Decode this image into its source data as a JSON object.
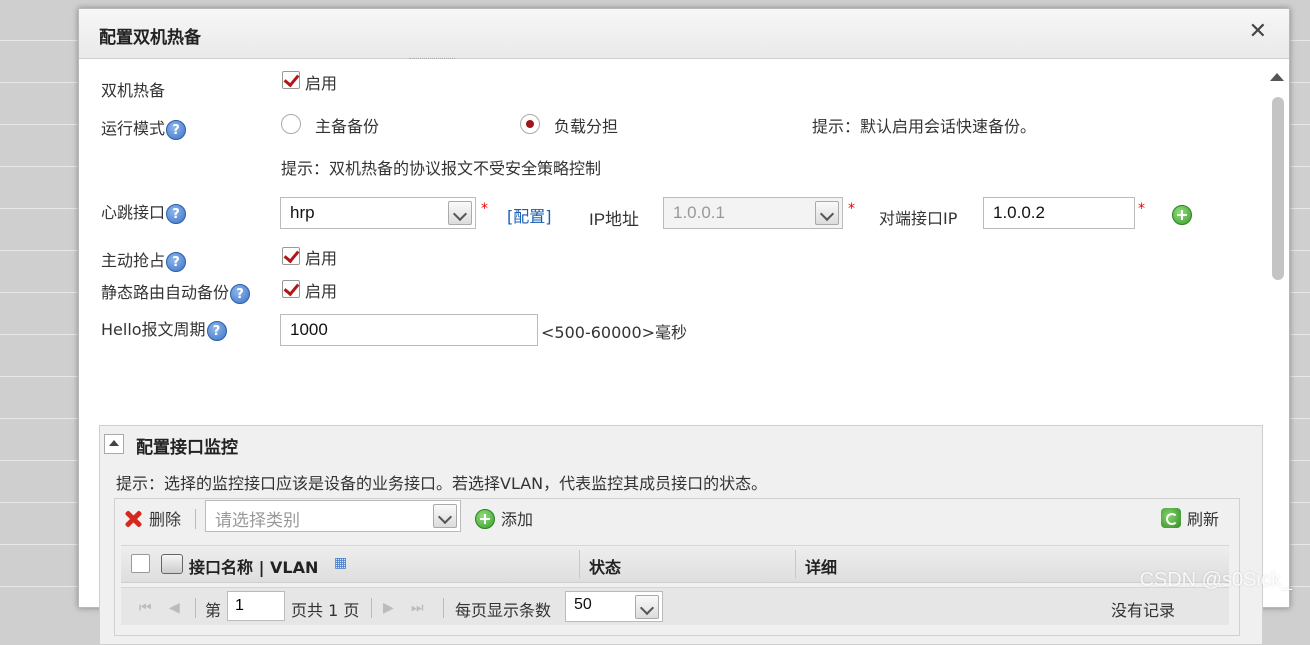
{
  "dialog": {
    "title": "配置双机热备"
  },
  "hot_standby": {
    "label": "双机热备",
    "enable_label": "启用",
    "enabled": true
  },
  "run_mode": {
    "label": "运行模式",
    "help": "?",
    "option_active_standby": "主备备份",
    "option_load_sharing": "负载分担",
    "selected": "负载分担",
    "hint": "提示：默认启用会话快速备份。"
  },
  "protocol_hint": "提示：双机热备的协议报文不受安全策略控制",
  "heartbeat": {
    "label": "心跳接口",
    "help": "?",
    "value": "hrp",
    "required": "*",
    "config_link": "[配置]",
    "ip_label": "IP地址",
    "ip_value": "1.0.0.1",
    "ip_required": "*",
    "peer_ip_label": "对端接口IP",
    "peer_ip_value": "1.0.0.2",
    "peer_required": "*"
  },
  "preempt": {
    "label": "主动抢占",
    "help": "?",
    "enable_label": "启用",
    "enabled": true
  },
  "static_route_backup": {
    "label": "静态路由自动备份",
    "help": "?",
    "enable_label": "启用",
    "enabled": true
  },
  "hello_period": {
    "label": "Hello报文周期",
    "help": "?",
    "value": "1000",
    "range": "<500-60000>毫秒"
  },
  "monitor_panel": {
    "title": "配置接口监控",
    "hint": "提示：选择的监控接口应该是设备的业务接口。若选择VLAN，代表监控其成员接口的状态。",
    "toolbar": {
      "delete_label": "删除",
      "category_placeholder": "请选择类别",
      "add_label": "添加",
      "refresh_label": "刷新"
    },
    "columns": {
      "interface": "接口名称 | VLAN",
      "status": "状态",
      "detail": "详细"
    },
    "pager": {
      "page_prefix": "第",
      "page_value": "1",
      "page_suffix": "页共 1 页",
      "per_page_label": "每页显示条数",
      "per_page_value": "50",
      "empty_text": "没有记录"
    }
  },
  "watermark": "CSDN @s0Sick_"
}
